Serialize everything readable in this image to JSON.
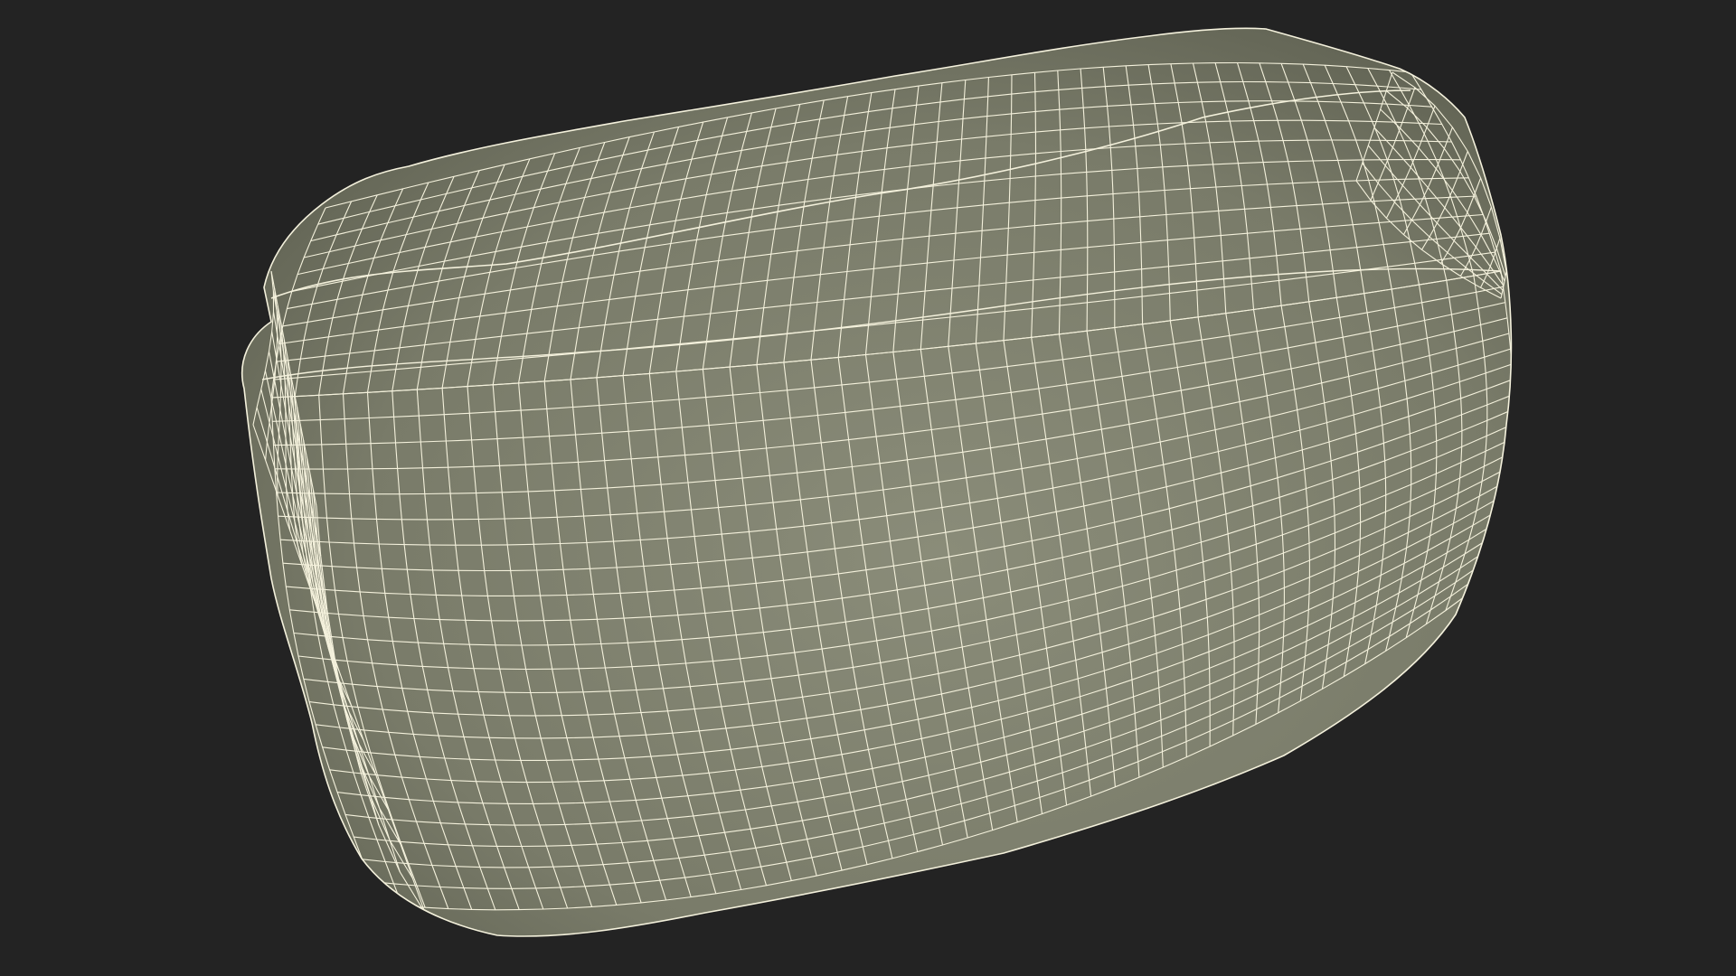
{
  "scene": {
    "background_color": "#232323",
    "mesh_fill_color": "#797b69",
    "mesh_wire_color": "#f4f1dc",
    "mesh_shade_color": "#5d5f50",
    "mesh_highlight_color": "#8a8c79",
    "subject": "wireframe-mesh-rounded-cushion"
  }
}
